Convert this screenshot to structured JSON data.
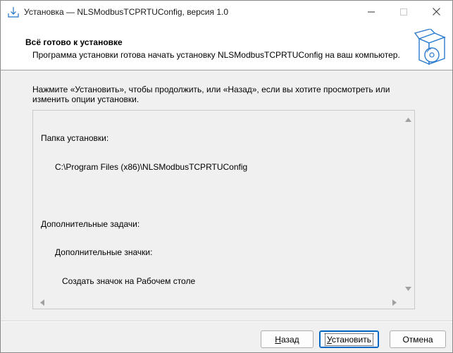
{
  "window": {
    "title": "Установка — NLSModbusTCPRTUConfig, версия 1.0"
  },
  "header": {
    "title": "Всё готово к установке",
    "subtitle": "Программа установки готова начать установку NLSModbusTCPRTUConfig на ваш компьютер."
  },
  "body": {
    "intro_line1": "Нажмите «Установить», чтобы продолжить, или «Назад», если вы хотите просмотреть или",
    "intro_line2": "изменить опции установки."
  },
  "summary": {
    "lines": [
      "Папка установки:",
      "      C:\\Program Files (x86)\\NLSModbusTCPRTUConfig",
      "",
      "Дополнительные задачи:",
      "      Дополнительные значки:",
      "         Создать значок на Рабочем столе"
    ]
  },
  "buttons": {
    "back_first": "Н",
    "back_rest": "азад",
    "install_first": "У",
    "install_rest": "становить",
    "cancel": "Отмена"
  },
  "colors": {
    "accent": "#0067c0",
    "window_bg": "#f0f0f0",
    "header_bg": "#ffffff"
  },
  "icons": {
    "app": "download-arrow-icon",
    "header": "software-box-cd-icon"
  }
}
